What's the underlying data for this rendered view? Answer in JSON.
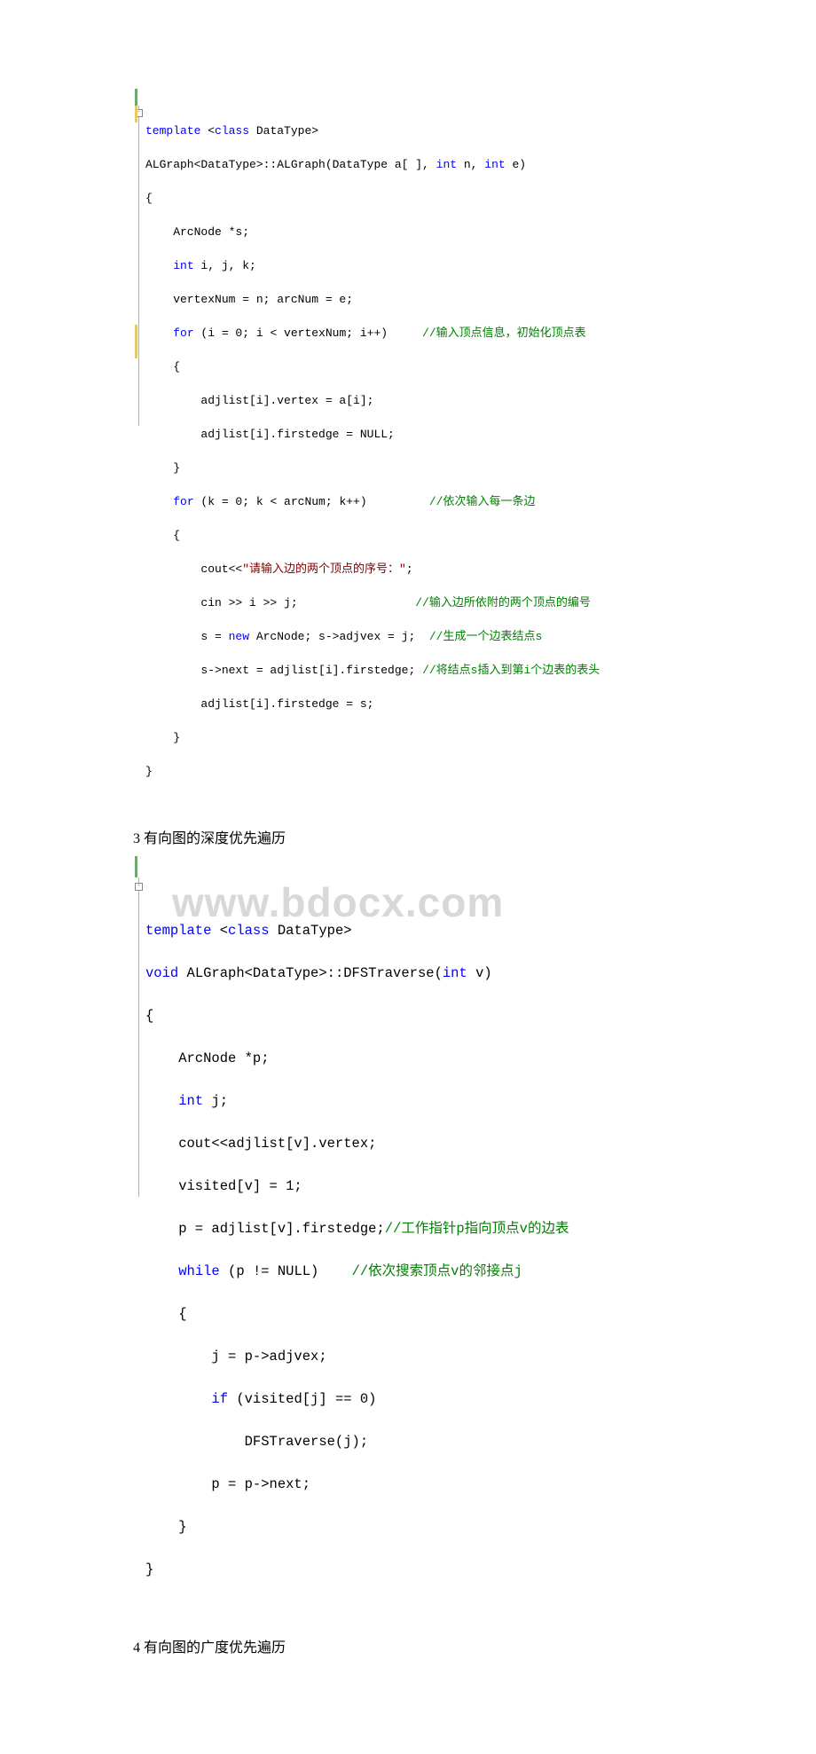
{
  "watermark": "www.bdocx.com",
  "section3": "3   有向图的深度优先遍历",
  "section4": "4   有向图的广度优先遍历",
  "code1": {
    "l1a": "template",
    "l1b": " <",
    "l1c": "class",
    "l1d": " DataType>",
    "l2a": "ALGraph<DataType>::ALGraph(DataType a[ ], ",
    "l2b": "int",
    "l2c": " n, ",
    "l2d": "int",
    "l2e": " e)",
    "l3": "{",
    "l4": "    ArcNode *s;",
    "l5a": "    ",
    "l5b": "int",
    "l5c": " i, j, k;",
    "l6": "    vertexNum = n; arcNum = e;",
    "l7a": "    ",
    "l7b": "for",
    "l7c": " (i = 0; i < vertexNum; i++)     ",
    "l7d": "//输入顶点信息，初始化顶点表",
    "l8": "    {",
    "l9": "        adjlist[i].vertex = a[i];",
    "l10": "        adjlist[i].firstedge = NULL;",
    "l11": "    }",
    "l12a": "    ",
    "l12b": "for",
    "l12c": " (k = 0; k < arcNum; k++)         ",
    "l12d": "//依次输入每一条边",
    "l13": "    {",
    "l14a": "        cout<<",
    "l14b": "\"请输入边的两个顶点的序号：\"",
    "l14c": ";",
    "l15a": "        cin >> i >> j;                 ",
    "l15b": "//输入边所依附的两个顶点的编号",
    "l16a": "        s = ",
    "l16b": "new",
    "l16c": " ArcNode; s->adjvex = j;  ",
    "l16d": "//生成一个边表结点s",
    "l17a": "        s->next = adjlist[i].firstedge; ",
    "l17b": "//将结点s插入到第i个边表的表头",
    "l18": "        adjlist[i].firstedge = s;",
    "l19": "    }",
    "l20": "}"
  },
  "code2": {
    "l1a": "template",
    "l1b": " <",
    "l1c": "class",
    "l1d": " DataType>",
    "l2a": "void",
    "l2b": " ALGraph<DataType>::DFSTraverse(",
    "l2c": "int",
    "l2d": " v)",
    "l3": "{",
    "l4": "    ArcNode *p;",
    "l5a": "    ",
    "l5b": "int",
    "l5c": " j;",
    "l6": "    cout<<adjlist[v].vertex;",
    "l7": "    visited[v] = 1;",
    "l8a": "    p = adjlist[v].firstedge;",
    "l8b": "//工作指针p指向顶点v的边表",
    "l9a": "    ",
    "l9b": "while",
    "l9c": " (p != NULL)    ",
    "l9d": "//依次搜索顶点v的邻接点j",
    "l10": "    {",
    "l11": "        j = p->adjvex;",
    "l12a": "        ",
    "l12b": "if",
    "l12c": " (visited[j] == 0)",
    "l13": "            DFSTraverse(j);",
    "l14": "        p = p->next;",
    "l15": "    }",
    "l16": "}"
  }
}
